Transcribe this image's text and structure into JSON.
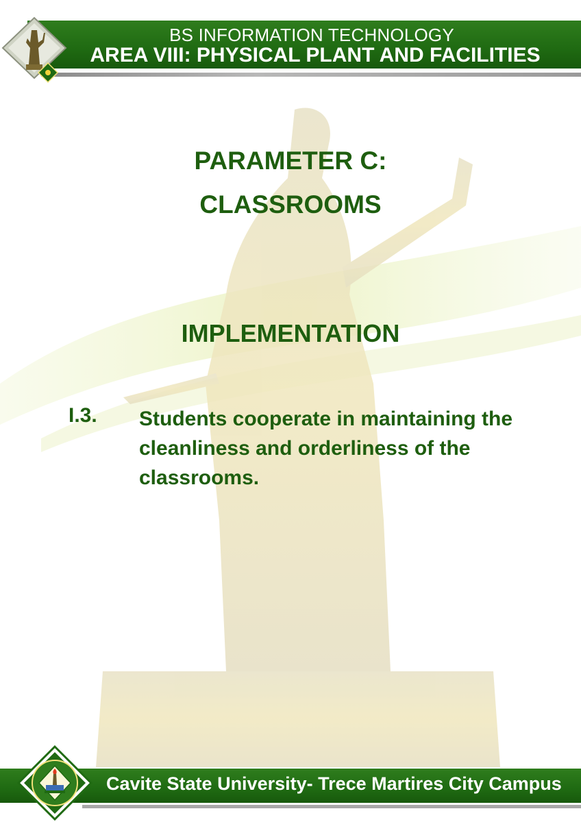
{
  "header": {
    "line1": "BS INFORMATION TECHNOLOGY",
    "line2": "AREA VIII: PHYSICAL PLANT AND FACILITIES"
  },
  "main": {
    "parameter_title": "PARAMETER C:",
    "parameter_name": "CLASSROOMS",
    "section_title": "IMPLEMENTATION",
    "item": {
      "number": "I.3.",
      "text": "Students cooperate in maintaining the cleanliness and orderliness of the classrooms."
    }
  },
  "footer": {
    "text": "Cavite State University- Trece Martires City Campus"
  },
  "colors": {
    "brand_green": "#1f6a12",
    "title_green": "#1e5e0f"
  }
}
